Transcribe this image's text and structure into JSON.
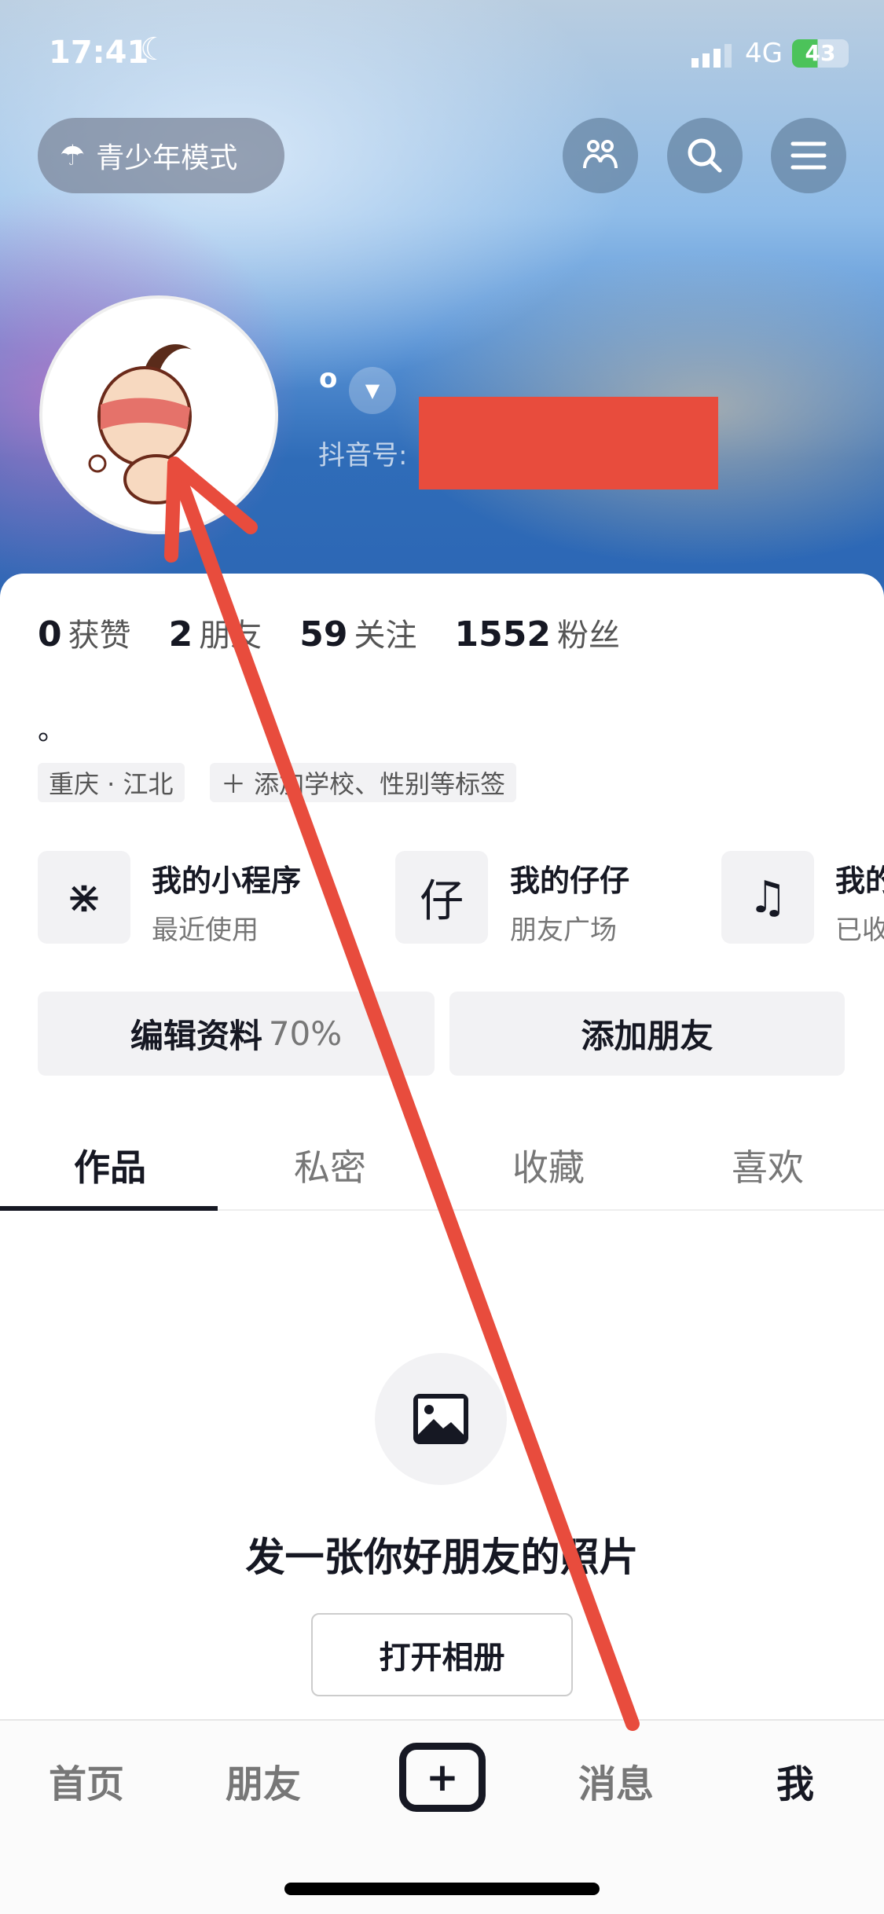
{
  "status_bar": {
    "time": "17:41",
    "network": "4G",
    "battery": "43"
  },
  "header": {
    "youth_mode": "青少年模式",
    "username": "o",
    "douyin_id_label": "抖音号:"
  },
  "stats": [
    {
      "value": "0",
      "label": "获赞"
    },
    {
      "value": "2",
      "label": "朋友"
    },
    {
      "value": "59",
      "label": "关注"
    },
    {
      "value": "1552",
      "label": "粉丝"
    }
  ],
  "bio": "。",
  "tags": [
    "重庆 · 江北",
    "＋ 添加学校、性别等标签"
  ],
  "shortcuts": [
    {
      "title": "我的小程序",
      "sub": "最近使用",
      "icon": "mini-program-icon"
    },
    {
      "title": "我的仔仔",
      "sub": "朋友广场",
      "icon": "zaizai-icon"
    },
    {
      "title": "我的",
      "sub": "已收",
      "icon": "music-note-icon"
    }
  ],
  "buttons": {
    "edit": "编辑资料",
    "edit_progress": "70%",
    "add_friend": "添加朋友"
  },
  "tabs": [
    "作品",
    "私密",
    "收藏",
    "喜欢"
  ],
  "empty": {
    "text": "发一张你好朋友的照片",
    "button": "打开相册"
  },
  "nav": [
    "首页",
    "朋友",
    "消息",
    "我"
  ],
  "colors": {
    "annotation": "#e84c3d",
    "header_blue": "#2c66b4"
  }
}
